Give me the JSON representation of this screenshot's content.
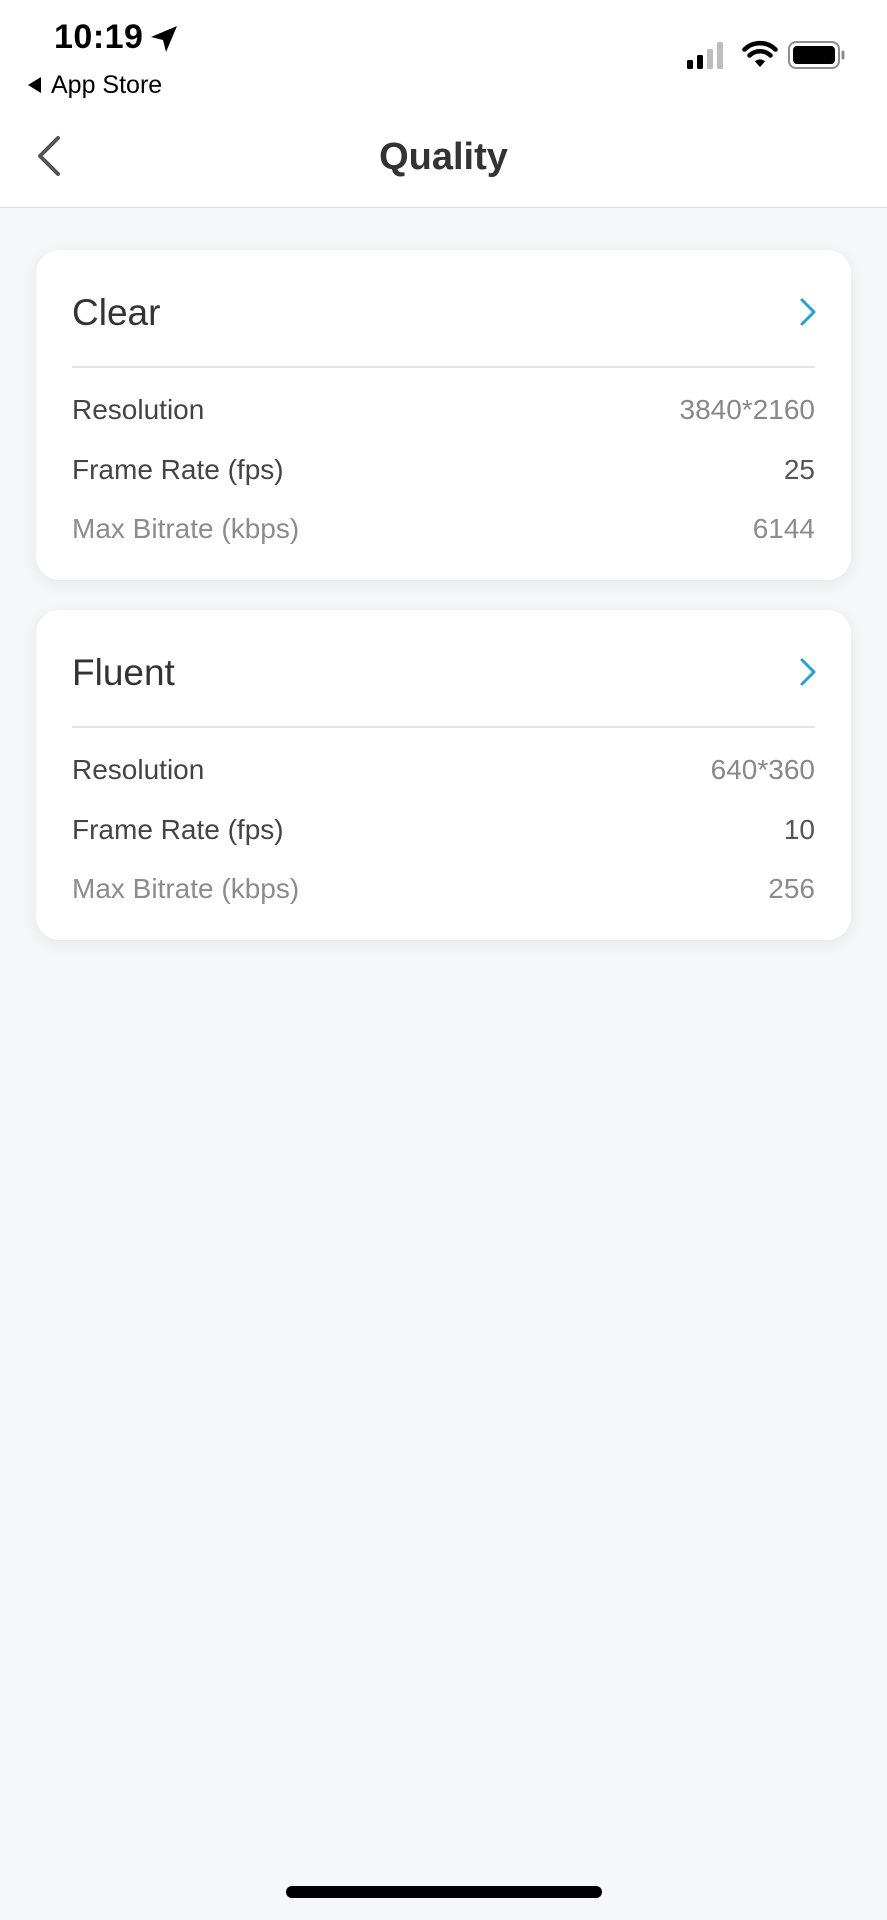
{
  "status_bar": {
    "time": "10:19",
    "back_app_label": "App Store"
  },
  "nav": {
    "title": "Quality"
  },
  "cards": [
    {
      "title": "Clear",
      "rows": [
        {
          "label": "Resolution",
          "value": "3840*2160"
        },
        {
          "label": "Frame Rate (fps)",
          "value": "25"
        },
        {
          "label": "Max Bitrate (kbps)",
          "value": "6144"
        }
      ]
    },
    {
      "title": "Fluent",
      "rows": [
        {
          "label": "Resolution",
          "value": "640*360"
        },
        {
          "label": "Frame Rate (fps)",
          "value": "10"
        },
        {
          "label": "Max Bitrate (kbps)",
          "value": "256"
        }
      ]
    }
  ],
  "colors": {
    "accent": "#2a9fd6",
    "background": "#f5f6f8",
    "card": "#ffffff",
    "text_primary": "#333333",
    "text_muted": "#8c8c8c"
  },
  "icons": {
    "location": "location-arrow-icon",
    "back_triangle": "back-triangle-icon",
    "signal": "cellular-signal-icon",
    "wifi": "wifi-icon",
    "battery": "battery-icon",
    "nav_back": "chevron-left-icon",
    "card_chevron": "chevron-right-icon"
  }
}
